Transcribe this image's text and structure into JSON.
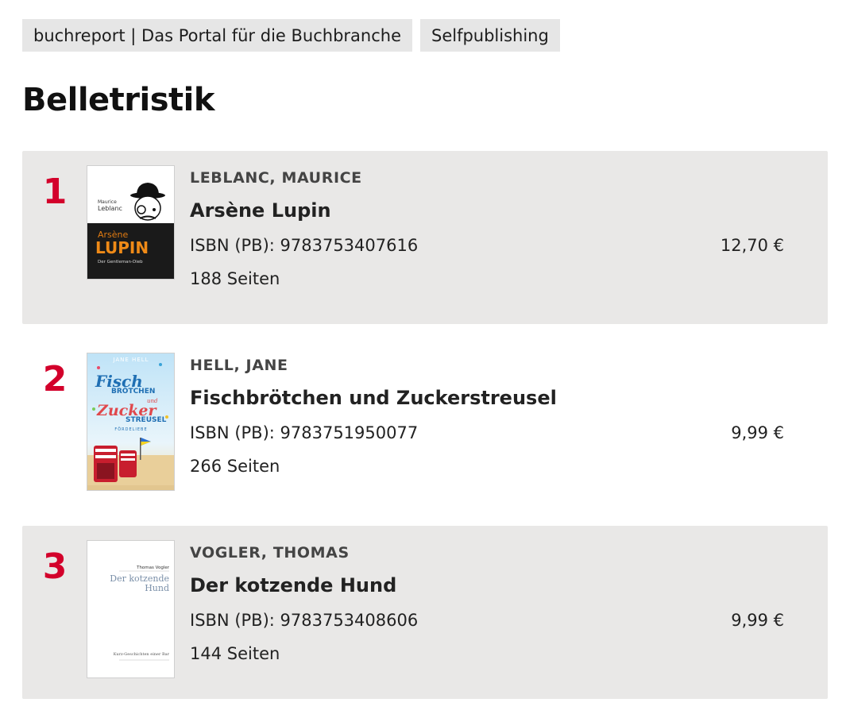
{
  "tags": [
    {
      "label": "buchreport | Das Portal für die Buchbranche"
    },
    {
      "label": "Selfpublishing"
    }
  ],
  "page_title": "Belletristik",
  "books": [
    {
      "rank": "1",
      "author": "LEBLANC, MAURICE",
      "title": "Arsène Lupin",
      "isbn": "ISBN (PB): 9783753407616",
      "pages": "188 Seiten",
      "price": "12,70 €",
      "cover": {
        "author_first": "Maurice",
        "author_last": "Leblanc",
        "title_small": "Arsène",
        "title_big": "LUPIN",
        "subtitle": "Der Gentleman-Dieb"
      }
    },
    {
      "rank": "2",
      "author": "HELL, JANE",
      "title": "Fischbrötchen und Zuckerstreusel",
      "isbn": "ISBN (PB): 9783751950077",
      "pages": "266 Seiten",
      "price": "9,99 €",
      "cover": {
        "author": "JANE HELL",
        "line1": "Fisch",
        "line2": "BRÖTCHEN",
        "line3": "und",
        "line4": "Zucker",
        "line5": "STREUSEL",
        "line6": "FÖRDELIEBE"
      }
    },
    {
      "rank": "3",
      "author": "VOGLER, THOMAS",
      "title": "Der kotzende Hund",
      "isbn": "ISBN (PB): 9783753408606",
      "pages": "144 Seiten",
      "price": "9,99 €",
      "cover": {
        "author": "Thomas Vogler",
        "title1": "Der kotzende",
        "title2": "Hund",
        "subtitle": "Kurz-Geschichten einer Bar"
      }
    }
  ],
  "colors": {
    "accent_red": "#d3002b",
    "row_shade": "#e9e8e7",
    "tag_bg": "#e6e6e6"
  }
}
